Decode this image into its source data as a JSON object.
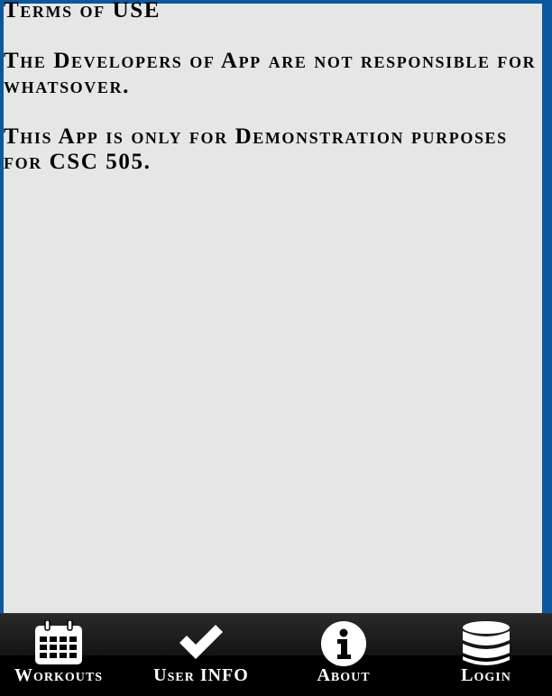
{
  "content": {
    "title": "Terms of USE",
    "paragraph_1": "The Developers of App are not responsible for whatsover.",
    "paragraph_2": "This App is only for Demonstration purposes for CSC 505."
  },
  "tabbar": {
    "tabs": [
      {
        "label": "Workouts",
        "icon": "calendar-icon"
      },
      {
        "label": "User INFO",
        "icon": "checkmark-icon"
      },
      {
        "label": "About",
        "icon": "info-icon"
      },
      {
        "label": "Login",
        "icon": "database-icon"
      }
    ]
  },
  "colors": {
    "frame": "#0b58a0",
    "content_bg": "#e6e6e6",
    "tabbar_bg": "#000000",
    "text": "#050505",
    "tab_text": "#ffffff"
  }
}
